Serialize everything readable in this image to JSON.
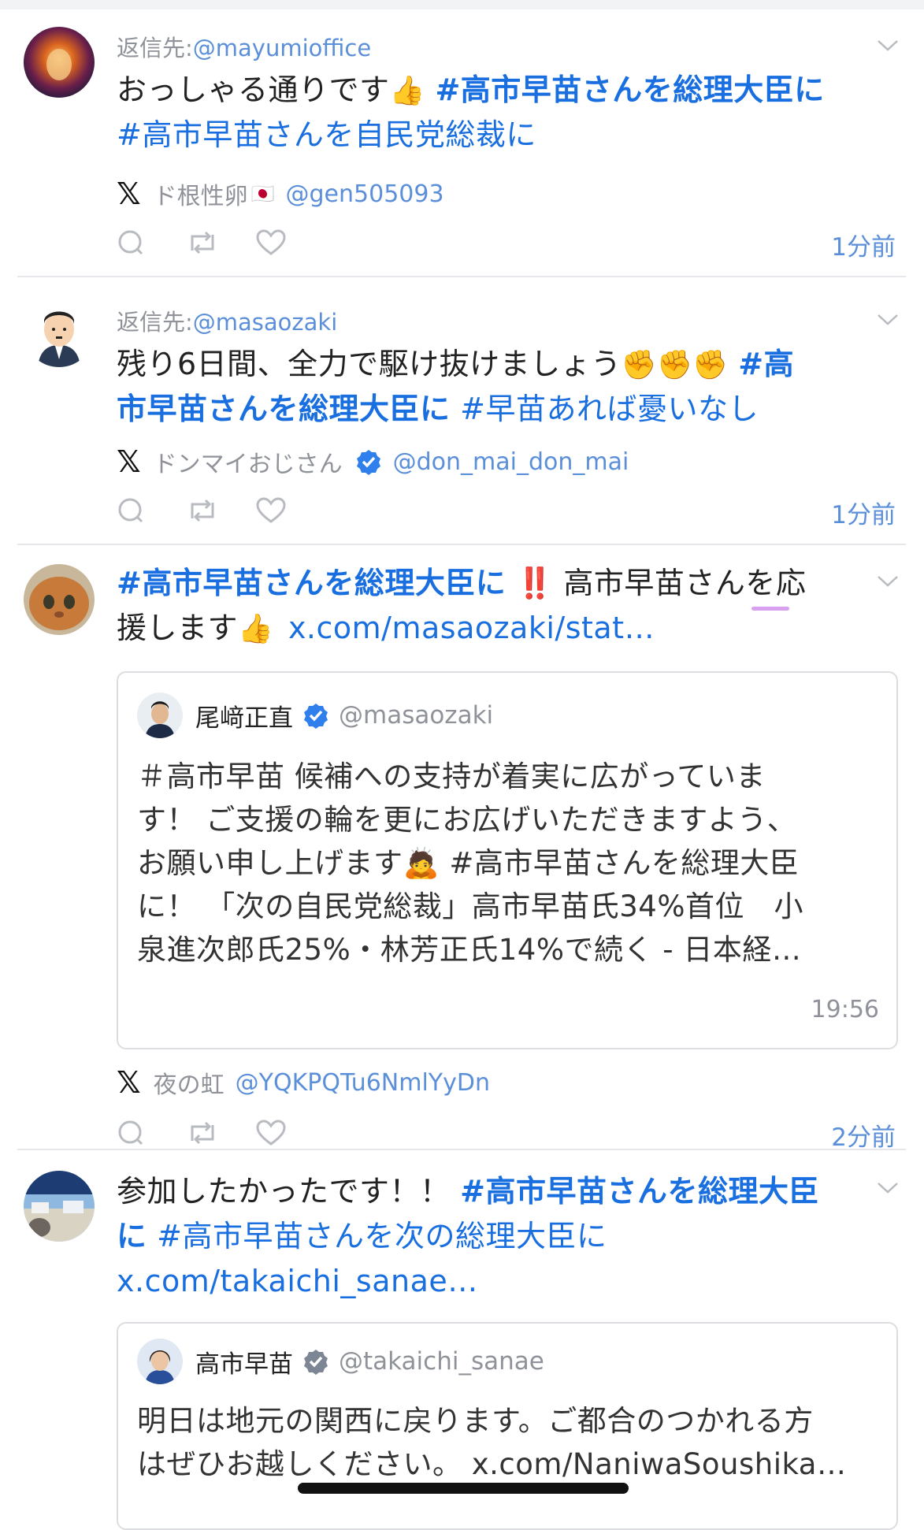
{
  "tweets": [
    {
      "reply_prefix": "返信先:",
      "reply_handle": "@mayumioffice",
      "body_text": "おっしゃる通りです",
      "emoji": "👍",
      "tag1": "#高市早苗さんを総理大臣に",
      "tag2": "#高市早苗さんを自民党総裁に",
      "author_name": "ド根性卵",
      "author_flag": "🇯🇵",
      "author_handle": "@gen505093",
      "time": "1分前"
    },
    {
      "reply_prefix": "返信先:",
      "reply_handle": "@masaozaki",
      "body_text": "残り6日間、全力で駆け抜けましょう",
      "emoji": "✊✊✊",
      "tag1_part1": "#高",
      "tag1_part2": "市早苗さんを総理大臣に",
      "tag2": "#早苗あれば憂いなし",
      "author_name": "ドンマイおじさん",
      "author_handle": "@don_mai_don_mai",
      "time": "1分前"
    },
    {
      "tag1": "#高市早苗さんを総理大臣に",
      "exclaim": "‼️",
      "body_text1": "高市早苗さんを応",
      "body_text2": "援します",
      "emoji": "👍",
      "link": "x.com/masaozaki/stat…",
      "quote": {
        "name": "尾﨑正直",
        "handle": "@masaozaki",
        "text_l1": "＃高市早苗 候補への支持が着実に広がっていま",
        "text_l2": "す！ ご支援の輪を更にお広げいただきますよう、",
        "text_l3a": "お願い申し上げます",
        "text_l3_emoji": "🙇",
        "text_l3b": " #高市早苗さんを総理大臣",
        "text_l4": "に！ 「次の自民党総裁」高市早苗氏34%首位　小",
        "text_l5": "泉進次郎氏25%・林芳正氏14%で続く - 日本経…",
        "time": "19:56"
      },
      "author_name": "夜の虹",
      "author_handle": "@YQKPQTu6NmlYyDn",
      "time": "2分前"
    },
    {
      "body_text": "参加したかったです！！",
      "tag1_part1": "#高市早苗さんを総理大臣",
      "tag1_part2": "に",
      "tag2": "#高市早苗さんを次の総理大臣に",
      "link": "x.com/takaichi_sanae…",
      "quote": {
        "name": "高市早苗",
        "handle": "@takaichi_sanae",
        "text_l1": "明日は地元の関西に戻ります。ご都合のつかれる方",
        "text_l2": "はぜひお越しください。 x.com/NaniwaSoushika…"
      }
    }
  ],
  "colors": {
    "link": "#1a6fe0",
    "meta": "#8f9399",
    "verified": "#2f80ed"
  },
  "icons": [
    "reply-icon",
    "retweet-icon",
    "like-icon",
    "chevron-down-icon",
    "x-logo-icon",
    "verified-badge-icon"
  ]
}
